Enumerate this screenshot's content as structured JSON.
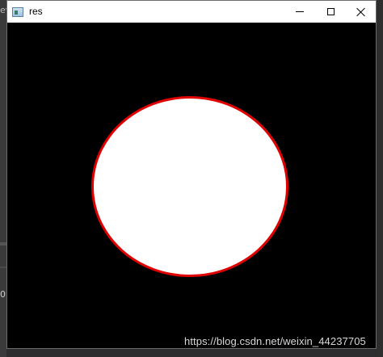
{
  "window": {
    "title": "res",
    "controls": {
      "minimize_icon": "minimize-icon",
      "maximize_icon": "maximize-icon",
      "close_icon": "close-icon"
    }
  },
  "image": {
    "background_color": "#000000",
    "shape": "ellipse",
    "fill_color": "#ffffff",
    "outline_color": "#e00000"
  },
  "watermark": {
    "text": "https://blog.csdn.net/weixin_44237705"
  },
  "background_glyphs": {
    "top_left": "ev",
    "mid_left": "0"
  }
}
